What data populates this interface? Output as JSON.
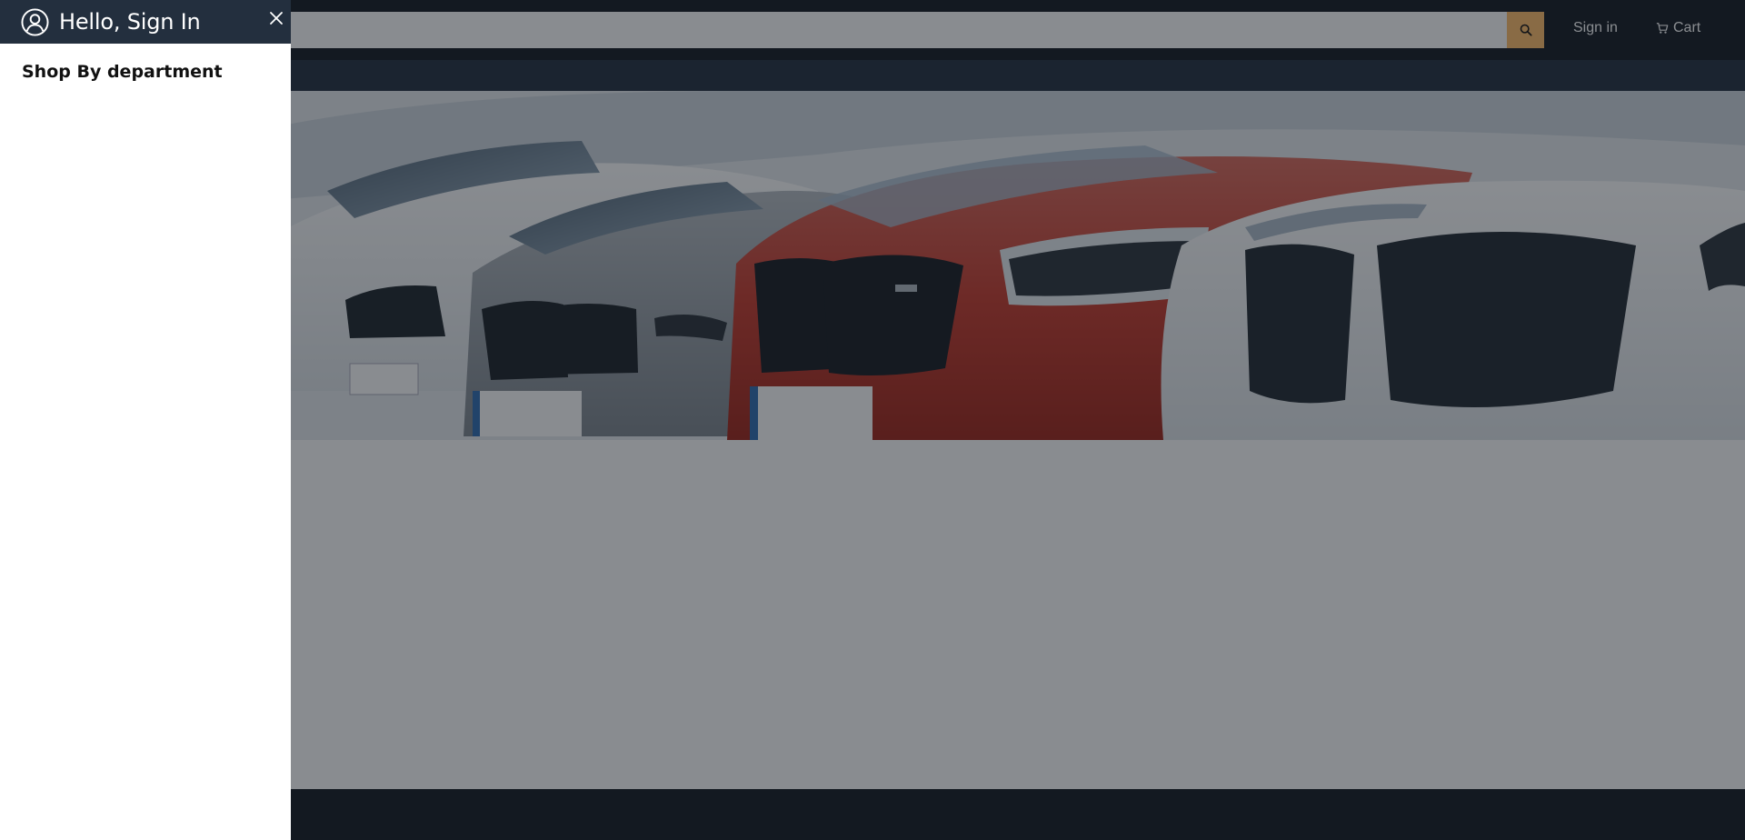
{
  "header": {
    "search": {
      "value": "",
      "placeholder": ""
    },
    "search_button_icon": "search-icon",
    "signin_label": "Sign in",
    "cart_label": "Cart",
    "cart_icon": "cart-icon"
  },
  "hero": {
    "image": "cars-lineup-banner"
  },
  "drawer": {
    "greeting": "Hello, Sign In",
    "user_icon": "user-circle-icon",
    "close_icon": "close-icon",
    "section_title": "Shop By department",
    "departments": []
  },
  "colors": {
    "header_bg": "#131921",
    "subnav_bg": "#232f3e",
    "drawer_header_bg": "#232f3e",
    "search_button_bg": "#febd69",
    "overlay": "rgba(19,25,33,0.5)",
    "footer_bg": "#131921"
  }
}
